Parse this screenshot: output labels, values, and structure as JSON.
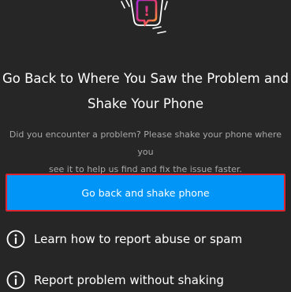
{
  "title": {
    "line1": "Go Back to Where You Saw the Problem and",
    "line2": "Shake Your Phone"
  },
  "description": {
    "line1": "Did you encounter a problem? Please shake your phone where you",
    "line2": "see it to help us find and fix the issue faster."
  },
  "primary_button": {
    "label": "Go back and shake phone"
  },
  "options": [
    {
      "label": "Learn how to report abuse or spam",
      "icon": "info-icon"
    },
    {
      "label": "Report problem without shaking",
      "icon": "info-icon"
    }
  ],
  "colors": {
    "background": "#262626",
    "accent": "#0095f6",
    "highlight_border": "#e0242f",
    "secondary_text": "#a8a8a8"
  },
  "illustration": {
    "icon": "shaking-phone-alert-icon",
    "badge_symbol": "!"
  }
}
